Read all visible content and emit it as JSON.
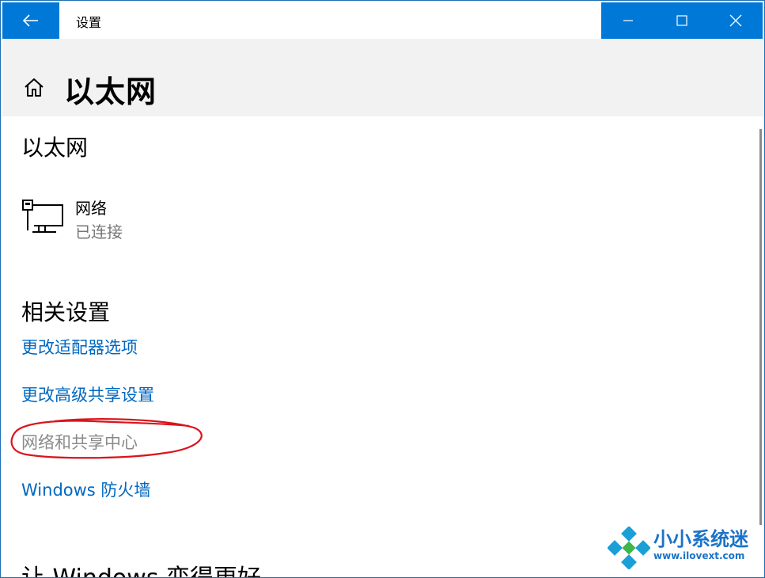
{
  "window": {
    "title": "设置"
  },
  "header": {
    "page_title": "以太网"
  },
  "section_ethernet": {
    "title": "以太网"
  },
  "network": {
    "name": "网络",
    "status": "已连接"
  },
  "related_settings": {
    "title": "相关设置",
    "links": [
      {
        "label": "更改适配器选项"
      },
      {
        "label": "更改高级共享设置"
      },
      {
        "label": "网络和共享中心"
      },
      {
        "label": "Windows 防火墙"
      }
    ]
  },
  "bottom_section": {
    "title": "让 Windows 变得更好"
  },
  "watermark": {
    "name": "小小系统迷",
    "url": "www.ilovext.com"
  },
  "colors": {
    "accent": "#0078d7",
    "link": "#0067c0",
    "annotation": "#d9151b"
  }
}
